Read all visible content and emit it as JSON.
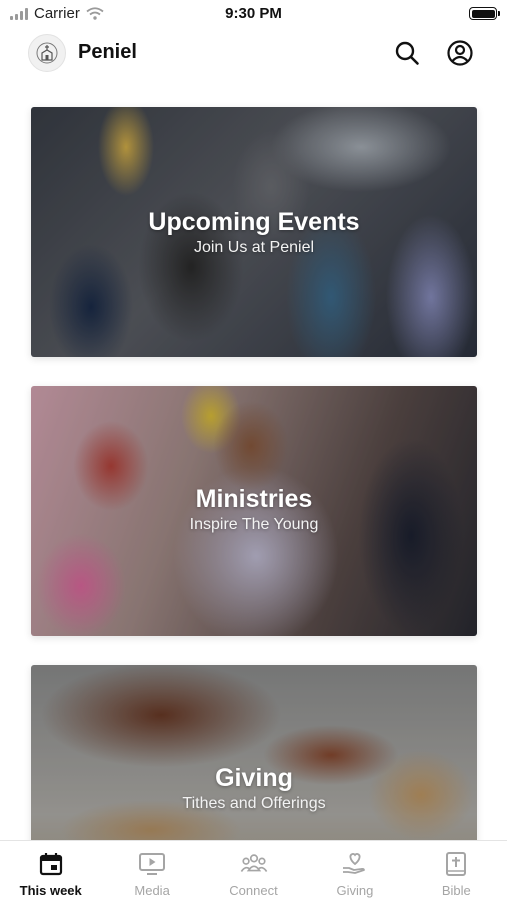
{
  "status_bar": {
    "carrier": "Carrier",
    "time": "9:30 PM"
  },
  "header": {
    "title": "Peniel",
    "icons": {
      "logo": "church-logo-icon",
      "search": "search-icon",
      "profile": "profile-icon"
    }
  },
  "cards": [
    {
      "title": "Upcoming Events",
      "subtitle": "Join Us at Peniel"
    },
    {
      "title": "Ministries",
      "subtitle": "Inspire The Young"
    },
    {
      "title": "Giving",
      "subtitle": "Tithes and Offerings"
    }
  ],
  "tabs": [
    {
      "label": "This week",
      "icon": "calendar-icon",
      "active": true
    },
    {
      "label": "Media",
      "icon": "play-screen-icon",
      "active": false
    },
    {
      "label": "Connect",
      "icon": "group-icon",
      "active": false
    },
    {
      "label": "Giving",
      "icon": "heart-hand-icon",
      "active": false
    },
    {
      "label": "Bible",
      "icon": "book-cross-icon",
      "active": false
    }
  ],
  "colors": {
    "active_tab": "#111111",
    "inactive_tab": "#a5a5a5",
    "background": "#ffffff"
  }
}
